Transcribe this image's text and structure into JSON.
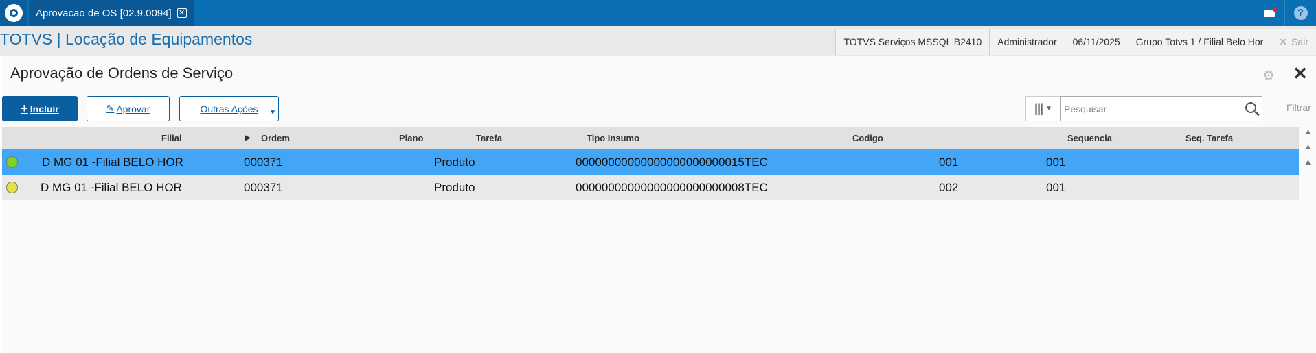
{
  "tab": {
    "title": "Aprovacao de OS [02.9.0094]",
    "close": "✕"
  },
  "header": {
    "app_title": "TOTVS | Locação de Equipamentos",
    "environment": "TOTVS Serviços MSSQL B2410",
    "user": "Administrador",
    "date": "06/11/2025",
    "branch": "Grupo Totvs 1 / Filial Belo Hor",
    "logout": "Sair"
  },
  "page": {
    "title": "Aprovação de Ordens de Serviço"
  },
  "toolbar": {
    "incluir": "Incluir",
    "aprovar": "Aprovar",
    "outras": "Outras Ações",
    "search_placeholder": "Pesquisar",
    "filtrar": "Filtrar"
  },
  "grid": {
    "columns": [
      "Filial",
      "Ordem",
      "Plano",
      "Tarefa",
      "Tipo Insumo",
      "Codigo",
      "Sequencia",
      "Seq. Tarefa"
    ],
    "rows": [
      {
        "status_color": "#7ed321",
        "filial": "D MG 01 -Filial BELO HOR",
        "ordem": "000371",
        "plano": "",
        "tarefa": "",
        "tipo_insumo": "Produto",
        "codigo": "00000000000000000000000015TEC",
        "sequencia": "001",
        "seq_tarefa": "001"
      },
      {
        "status_color": "#e8e24a",
        "filial": "D MG 01 -Filial BELO HOR",
        "ordem": "000371",
        "plano": "",
        "tarefa": "",
        "tipo_insumo": "Produto",
        "codigo": "00000000000000000000000008TEC",
        "sequencia": "002",
        "seq_tarefa": "001"
      }
    ]
  },
  "colors": {
    "topbar": "#0b6fb4",
    "selected_row": "#42a5f5",
    "primary_button": "#0a5f9e"
  }
}
